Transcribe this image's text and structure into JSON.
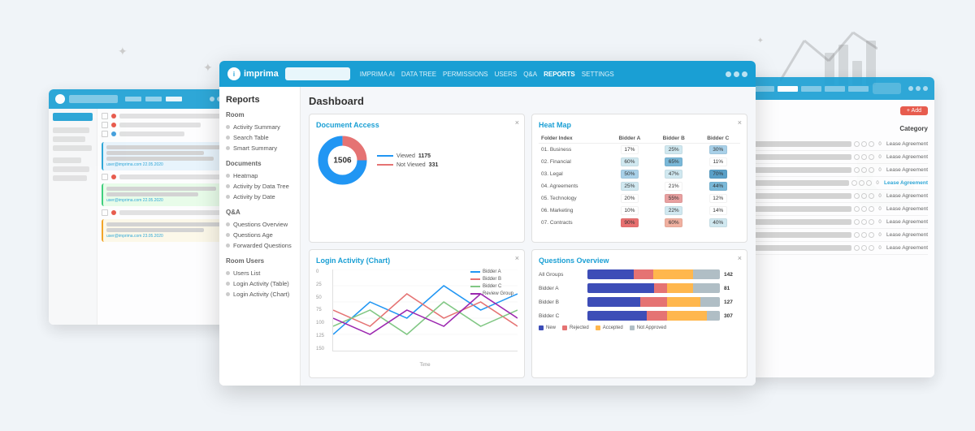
{
  "app": {
    "logo": "imprima",
    "nav_links": [
      "IMPRIMA AI",
      "DATA TREE",
      "PERMISSIONS",
      "USERS",
      "Q&A",
      "REPORTS",
      "SETTINGS"
    ],
    "active_nav": "REPORTS"
  },
  "sidebar": {
    "title": "Reports",
    "sections": [
      {
        "title": "Room",
        "items": [
          "Activity Summary",
          "Search Table",
          "Smart Summary"
        ]
      },
      {
        "title": "Documents",
        "items": [
          "Heatmap",
          "Activity by Data Tree",
          "Activity by Date"
        ]
      },
      {
        "title": "Q&A",
        "items": [
          "Questions Overview",
          "Questions Age",
          "Forwarded Questions"
        ]
      },
      {
        "title": "Room Users",
        "items": [
          "Users List",
          "Login Activity (Table)",
          "Login Activity (Chart)"
        ]
      }
    ]
  },
  "dashboard": {
    "title": "Dashboard",
    "cards": {
      "document_access": {
        "title": "Document Access",
        "total": "1506",
        "viewed": "1175",
        "not_viewed": "331",
        "legend": [
          {
            "label": "Viewed",
            "value": "1175",
            "color": "#2196F3"
          },
          {
            "label": "Not Viewed",
            "value": "331",
            "color": "#E57373"
          }
        ]
      },
      "heat_map": {
        "title": "Heat Map",
        "headers": [
          "Folder Index",
          "Bidder A",
          "Bidder B",
          "Bidder C"
        ],
        "rows": [
          {
            "folder": "01. Business",
            "a": "17%",
            "b": "25%",
            "c": "30%",
            "a_color": "#fff",
            "b_color": "#d0e8f0",
            "c_color": "#a8d0e8"
          },
          {
            "folder": "02. Financial",
            "a": "60%",
            "b": "65%",
            "c": "11%",
            "a_color": "#d0e8f0",
            "b_color": "#7ab8d8",
            "c_color": "#fff"
          },
          {
            "folder": "03. Legal",
            "a": "50%",
            "b": "47%",
            "c": "70%",
            "a_color": "#a8d0e8",
            "b_color": "#d0e8f0",
            "c_color": "#5aa0c8"
          },
          {
            "folder": "04. Agreements",
            "a": "25%",
            "b": "21%",
            "c": "44%",
            "a_color": "#d0e8f0",
            "b_color": "#fff",
            "c_color": "#7ab8d8"
          },
          {
            "folder": "05. Technology",
            "a": "20%",
            "b": "55%",
            "c": "12%",
            "a_color": "#fff",
            "b_color": "#e8a0a0",
            "c_color": "#fff"
          },
          {
            "folder": "06. Marketing",
            "a": "10%",
            "b": "22%",
            "c": "14%",
            "a_color": "#fff",
            "b_color": "#d0e8f0",
            "c_color": "#fff"
          },
          {
            "folder": "07. Contracts",
            "a": "90%",
            "b": "60%",
            "c": "40%",
            "a_color": "#e87070",
            "b_color": "#f0b0a0",
            "c_color": "#d0e8f0"
          }
        ]
      },
      "login_activity": {
        "title": "Login Activity (Chart)",
        "y_labels": [
          "150",
          "125",
          "100",
          "75",
          "50",
          "25",
          "0"
        ],
        "x_label": "Time",
        "legend": [
          {
            "label": "Bidder A",
            "color": "#2196F3"
          },
          {
            "label": "Bidder B",
            "color": "#E57373"
          },
          {
            "label": "Bidder C",
            "color": "#81C784"
          },
          {
            "label": "Review Group",
            "color": "#9C27B0"
          }
        ]
      },
      "questions_overview": {
        "title": "Questions Overview",
        "bars": [
          {
            "label": "All Groups",
            "segments": [
              {
                "color": "#3d4db7",
                "pct": 35
              },
              {
                "color": "#e57373",
                "pct": 15
              },
              {
                "color": "#ffb74d",
                "pct": 30
              },
              {
                "color": "#b0bec5",
                "pct": 20
              }
            ],
            "value": "142"
          },
          {
            "label": "Bidder A",
            "segments": [
              {
                "color": "#3d4db7",
                "pct": 50
              },
              {
                "color": "#e57373",
                "pct": 10
              },
              {
                "color": "#ffb74d",
                "pct": 20
              },
              {
                "color": "#b0bec5",
                "pct": 20
              }
            ],
            "value": "81"
          },
          {
            "label": "Bidder B",
            "segments": [
              {
                "color": "#3d4db7",
                "pct": 40
              },
              {
                "color": "#e57373",
                "pct": 20
              },
              {
                "color": "#ffb74d",
                "pct": 25
              },
              {
                "color": "#b0bec5",
                "pct": 15
              }
            ],
            "value": "127"
          },
          {
            "label": "Bidder C",
            "segments": [
              {
                "color": "#3d4db7",
                "pct": 45
              },
              {
                "color": "#e57373",
                "pct": 15
              },
              {
                "color": "#ffb74d",
                "pct": 30
              },
              {
                "color": "#b0bec5",
                "pct": 10
              }
            ],
            "value": "307"
          }
        ],
        "legend": [
          "New",
          "Rejected",
          "Accepted",
          "Not Approved"
        ]
      }
    }
  },
  "right_panel": {
    "category_label": "Category",
    "items": [
      "Lease Agreement",
      "Lease Agreement",
      "Lease Agreement",
      "Lease Agreement",
      "Lease Agreement",
      "Lease Agreement",
      "Lease Agreement",
      "Lease Agreement",
      "Lease Agreement"
    ]
  },
  "colors": {
    "primary": "#1a9fd4",
    "accent": "#e74c3c",
    "bg": "#f5f7fa"
  }
}
